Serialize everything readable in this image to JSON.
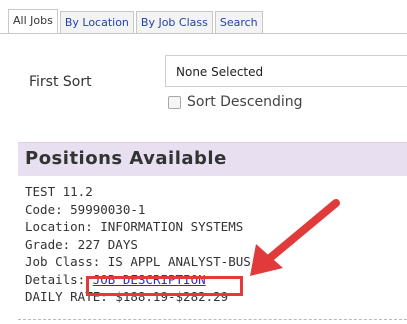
{
  "tabs": [
    {
      "label": "All Jobs",
      "active": true
    },
    {
      "label": "By Location",
      "active": false
    },
    {
      "label": "By Job Class",
      "active": false
    },
    {
      "label": "Search",
      "active": false
    }
  ],
  "sort": {
    "first_sort_label": "First Sort",
    "selected_value": "None Selected",
    "descending_label": "Sort Descending",
    "descending_checked": false
  },
  "positions": {
    "title": "Positions Available",
    "job": {
      "title": "TEST 11.2",
      "code": "Code: 59990030-1",
      "location": "Location: INFORMATION SYSTEMS",
      "grade": "Grade: 227 DAYS",
      "job_class": "Job Class: IS APPL ANALYST-BUS",
      "details_label": "Details:",
      "details_link": "JOB DESCRIPTION",
      "daily_rate": "DAILY RATE: $188.19-$282.29"
    }
  },
  "colors": {
    "header_background": "#e8e0f0",
    "annotation": "#e03a3a",
    "link": "#2233cc"
  }
}
